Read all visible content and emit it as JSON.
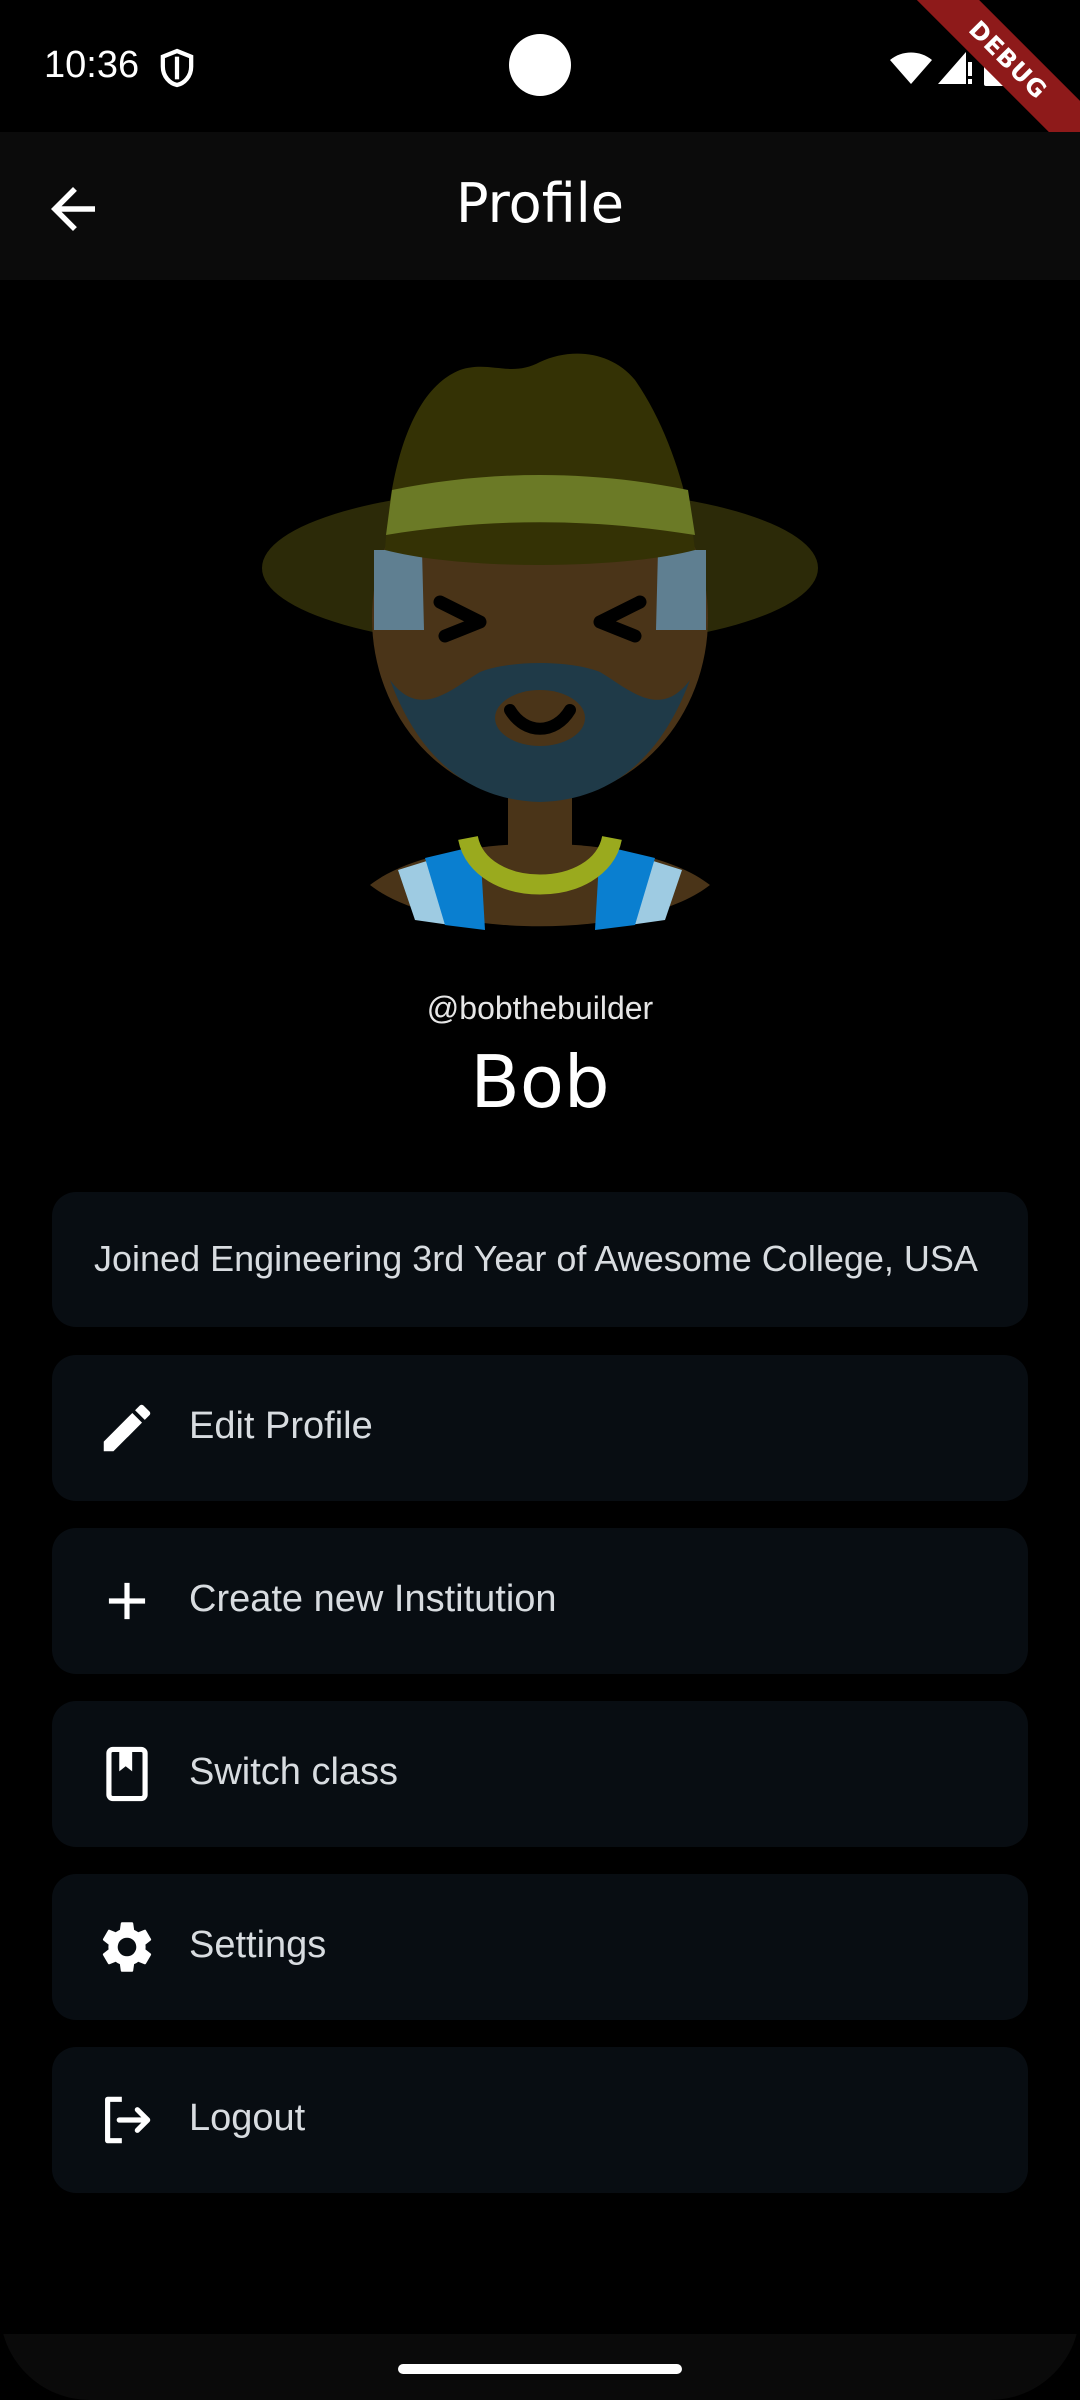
{
  "status_bar": {
    "time": "10:36",
    "debug_label": "DEBUG"
  },
  "app_bar": {
    "title": "Profile",
    "back_icon": "arrow-left-icon"
  },
  "profile": {
    "username": "@bobthebuilder",
    "name": "Bob",
    "info": "Joined Engineering 3rd Year of Awesome College, USA"
  },
  "menu": [
    {
      "label": "Edit Profile",
      "icon": "pencil-icon"
    },
    {
      "label": "Create new Institution",
      "icon": "plus-icon"
    },
    {
      "label": "Switch class",
      "icon": "book-icon"
    },
    {
      "label": "Settings",
      "icon": "gear-icon"
    },
    {
      "label": "Logout",
      "icon": "logout-icon"
    }
  ],
  "colors": {
    "background": "#000000",
    "card": "#080d12",
    "app_bar": "#0b0b0b",
    "debug_ribbon": "#8e1a1a"
  }
}
